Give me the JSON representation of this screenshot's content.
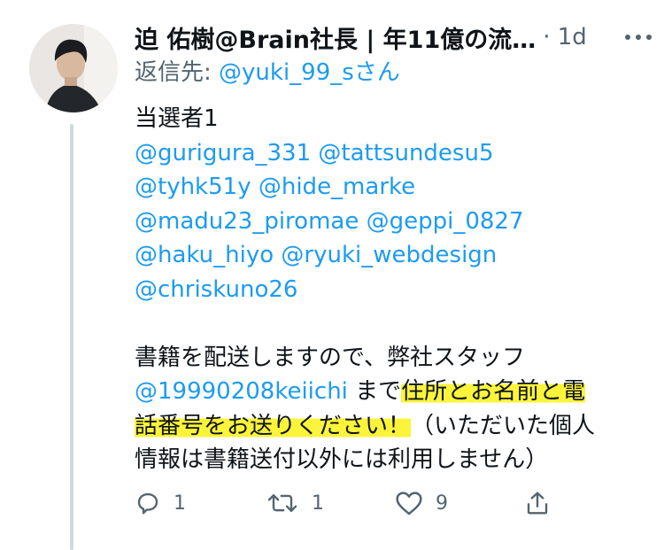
{
  "tweet": {
    "author_display": "迫 佑樹@Brain社長 | 年11億の流…",
    "time": "· 1d",
    "reply_to_prefix": "返信先: ",
    "reply_to_handle": "@yuki_99_s",
    "reply_to_suffix": "さん",
    "lines": {
      "l1": "当選者1",
      "l2a": "@gurigura_331",
      "l2b": "@tattsundesu5",
      "l3a": "@tyhk51y",
      "l3b": "@hide_marke",
      "l4a": "@madu23_piromae",
      "l4b": "@geppi_0827",
      "l5a": "@haku_hiyo",
      "l5b": "@ryuki_webdesign",
      "l6": "@chriskuno26",
      "l7": "書籍を配送しますので、弊社スタッフ",
      "l8_mention": "@19990208keiichi",
      "l8_text": " まで",
      "l8_highlight": "住所とお名前と電",
      "l9_highlight": "話番号をお送りください！",
      "l9_text": "（いただいた個人",
      "l10": "情報は書籍送付以外には利用しません）"
    },
    "actions": {
      "reply_count": "1",
      "retweet_count": "1",
      "like_count": "9"
    }
  },
  "icons": [
    "avatar",
    "more-icon",
    "reply-icon",
    "retweet-icon",
    "like-icon",
    "share-icon"
  ],
  "colors": {
    "link": "#1d9bf0",
    "secondary_text": "#536471",
    "highlight": "#fbf43a",
    "thread_line": "#cfd9de"
  }
}
